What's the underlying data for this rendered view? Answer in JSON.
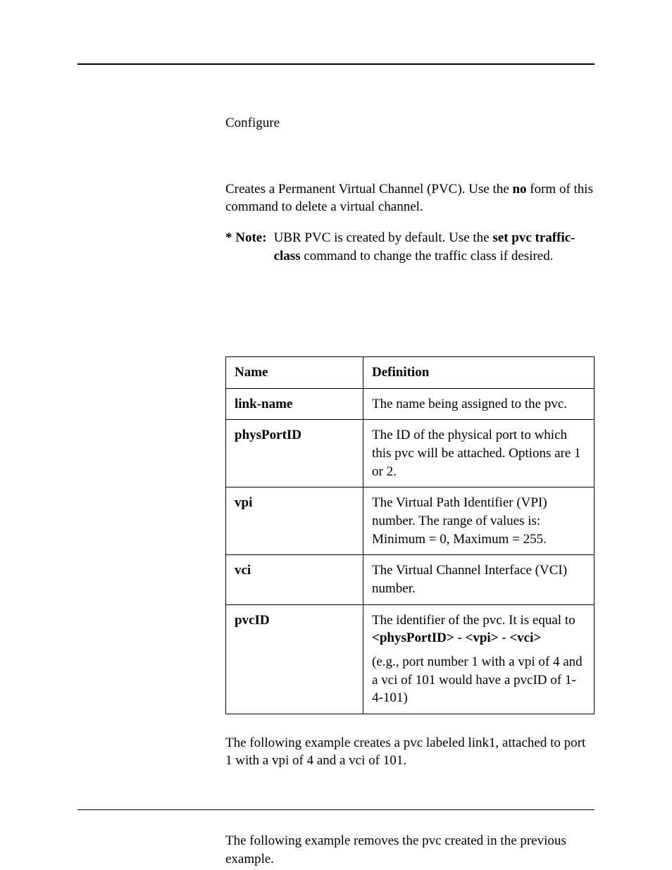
{
  "mode": "Configure",
  "intro": {
    "pre": "Creates a Permanent Virtual Channel (PVC). Use the ",
    "bold1": "no",
    "post": " form of this command to delete a virtual channel."
  },
  "note": {
    "label": "* Note:",
    "pre": "UBR PVC is created by default. Use the ",
    "bold1": "set pvc traffic-class",
    "post": " command to change the traffic class if desired."
  },
  "table": {
    "headers": {
      "name": "Name",
      "definition": "Definition"
    },
    "rows": [
      {
        "name": "link-name",
        "def": "The name being assigned to the pvc."
      },
      {
        "name": "physPortID",
        "def": "The ID of the physical port to which this pvc will be attached. Options are 1 or 2."
      },
      {
        "name": "vpi",
        "def": "The Virtual Path Identifier (VPI) number. The range of values is: Minimum = 0, Maximum = 255."
      },
      {
        "name": "vci",
        "def": "The Virtual Channel Interface (VCI) number."
      },
      {
        "name": "pvcID",
        "def_p1_pre": "The identifier of the pvc. It is equal to ",
        "def_p1_b1": "<physPortID>",
        "def_p1_m1": " - ",
        "def_p1_b2": "<vpi>",
        "def_p1_m2": " - ",
        "def_p1_b3": "<vci>",
        "def_p2": "(e.g., port number 1 with a vpi of 4 and a vci of 101 would have a pvcID of 1-4-101)"
      }
    ]
  },
  "example1": "The following example creates a pvc labeled link1, attached to port 1 with a vpi of 4 and a vci of 101.",
  "example2": "The following example removes the pvc created in the previous example."
}
